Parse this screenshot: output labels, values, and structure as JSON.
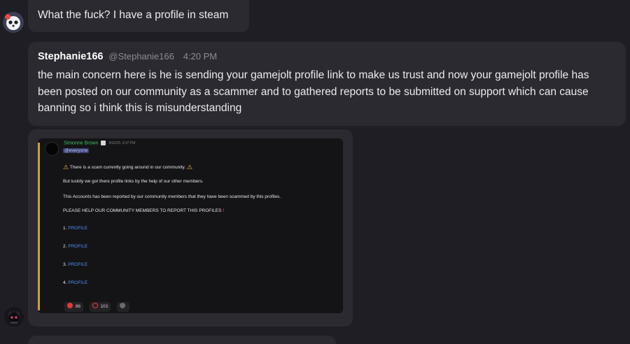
{
  "messages": [
    {
      "text": "What the fuck? I have a profile in steam",
      "avatar_icon": "panda-avatar-icon"
    },
    {
      "author": "Stephanie166",
      "handle": "@Stephanie166",
      "time": "4:20 PM",
      "text": "the main concern here is he is sending your gamejolt profile link to make us trust and now your gamejolt profile has been posted on our community as a scammer and to gathered reports to be submitted on support which can cause banning so i think this is misunderstanding"
    }
  ],
  "attachment": {
    "author": "Simonne Brown",
    "date": "9/16/25, 9:37 PM",
    "mention": "@everyone",
    "lines": {
      "alert": "There is a scam currently going around in our community.",
      "luck": "But luckily we got there  profile links by the help of our other members.",
      "reported": "This Accounts has been reported by our  community members that they have been scammed by this profiles.",
      "help": "PLEASE HELP OUR COMMUNITY MEMBERS TO REPORT THIS PROFILES"
    },
    "profiles": [
      {
        "num": "1.",
        "label": "PROFILE"
      },
      {
        "num": "2.",
        "label": "PROFILE"
      },
      {
        "num": "3.",
        "label": "PROFILE"
      },
      {
        "num": "4.",
        "label": "PROFILE"
      }
    ],
    "reactions": [
      {
        "icon": "angry-face-icon",
        "count": "86"
      },
      {
        "icon": "no-entry-icon",
        "count": "103"
      }
    ]
  },
  "colors": {
    "background": "#1f1e24",
    "bubble": "#2b2a30",
    "link": "#4f8ff0",
    "author_green": "#3fc05a",
    "mention_bg": "#3b3f71"
  }
}
